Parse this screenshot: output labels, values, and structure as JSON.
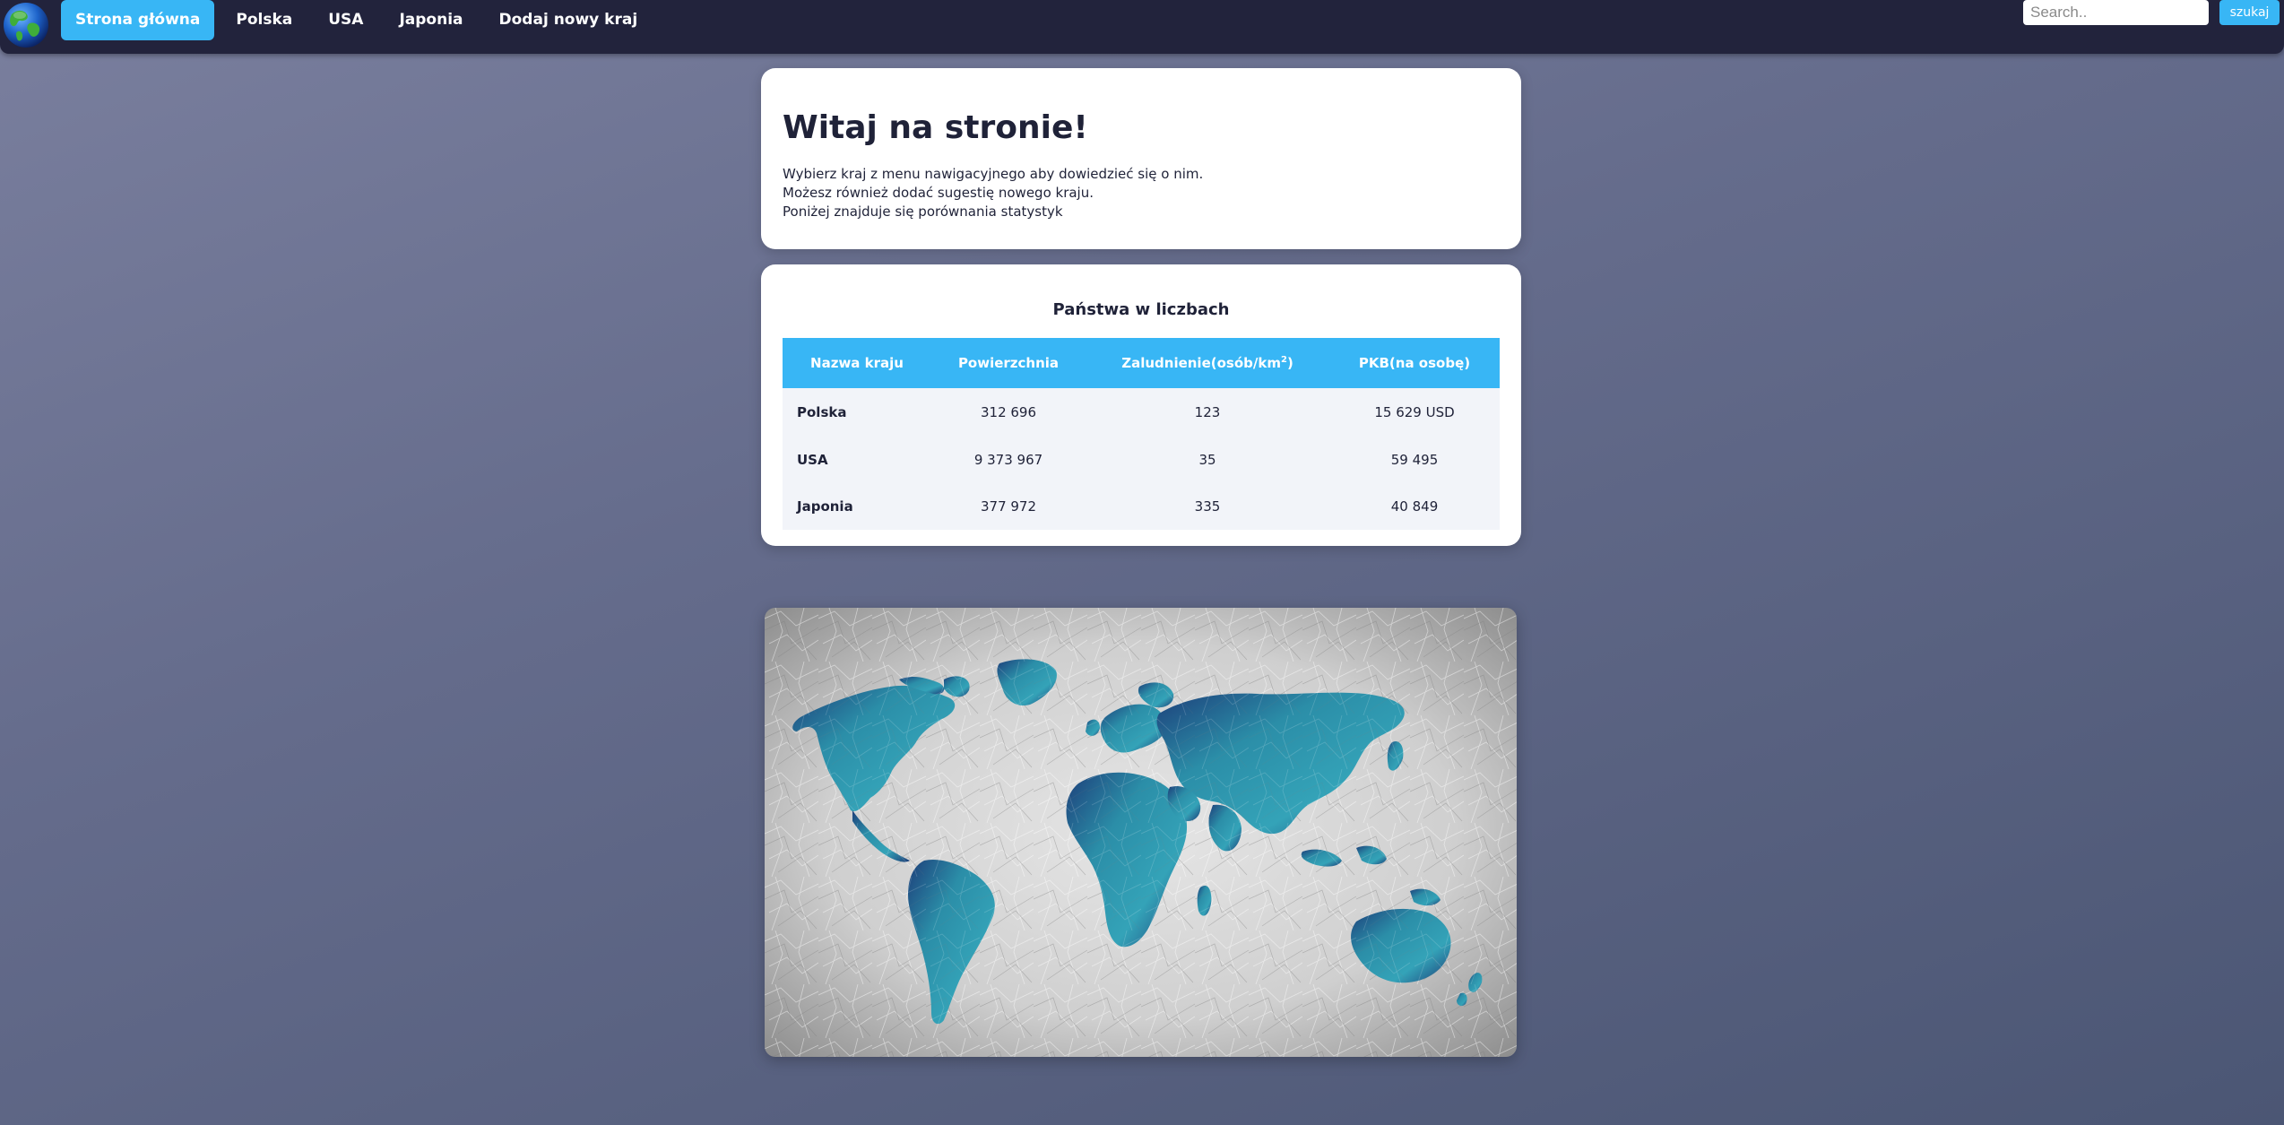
{
  "nav": {
    "links": [
      {
        "label": "Strona główna",
        "active": true
      },
      {
        "label": "Polska",
        "active": false
      },
      {
        "label": "USA",
        "active": false
      },
      {
        "label": "Japonia",
        "active": false
      },
      {
        "label": "Dodaj nowy kraj",
        "active": false
      }
    ],
    "logo_icon": "globe-icon"
  },
  "search": {
    "placeholder": "Search..",
    "value": "",
    "button_label": "szukaj"
  },
  "welcome": {
    "title": "Witaj na stronie!",
    "lines": [
      "Wybierz kraj z menu nawigacyjnego aby dowiedzieć się o nim.",
      "Możesz również dodać sugestię nowego kraju.",
      "Poniżej znajduje się porównania statystyk"
    ]
  },
  "stats": {
    "title": "Państwa w liczbach",
    "headers": {
      "name": "Nazwa kraju",
      "area": "Powierzchnia",
      "density": "Zaludnienie(osób/km",
      "density_sup": "2",
      "density_close": ")",
      "gdp": "PKB(na osobę)"
    },
    "rows": [
      {
        "name": "Polska",
        "area": "312 696",
        "density": "123",
        "gdp": "15 629 USD"
      },
      {
        "name": "USA",
        "area": "9 373 967",
        "density": "35",
        "gdp": "59 495"
      },
      {
        "name": "Japonia",
        "area": "377 972",
        "density": "335",
        "gdp": "40 849"
      }
    ]
  },
  "colors": {
    "accent": "#38b6f5",
    "navbar": "#22233c",
    "continents": "#2a8fa8"
  }
}
